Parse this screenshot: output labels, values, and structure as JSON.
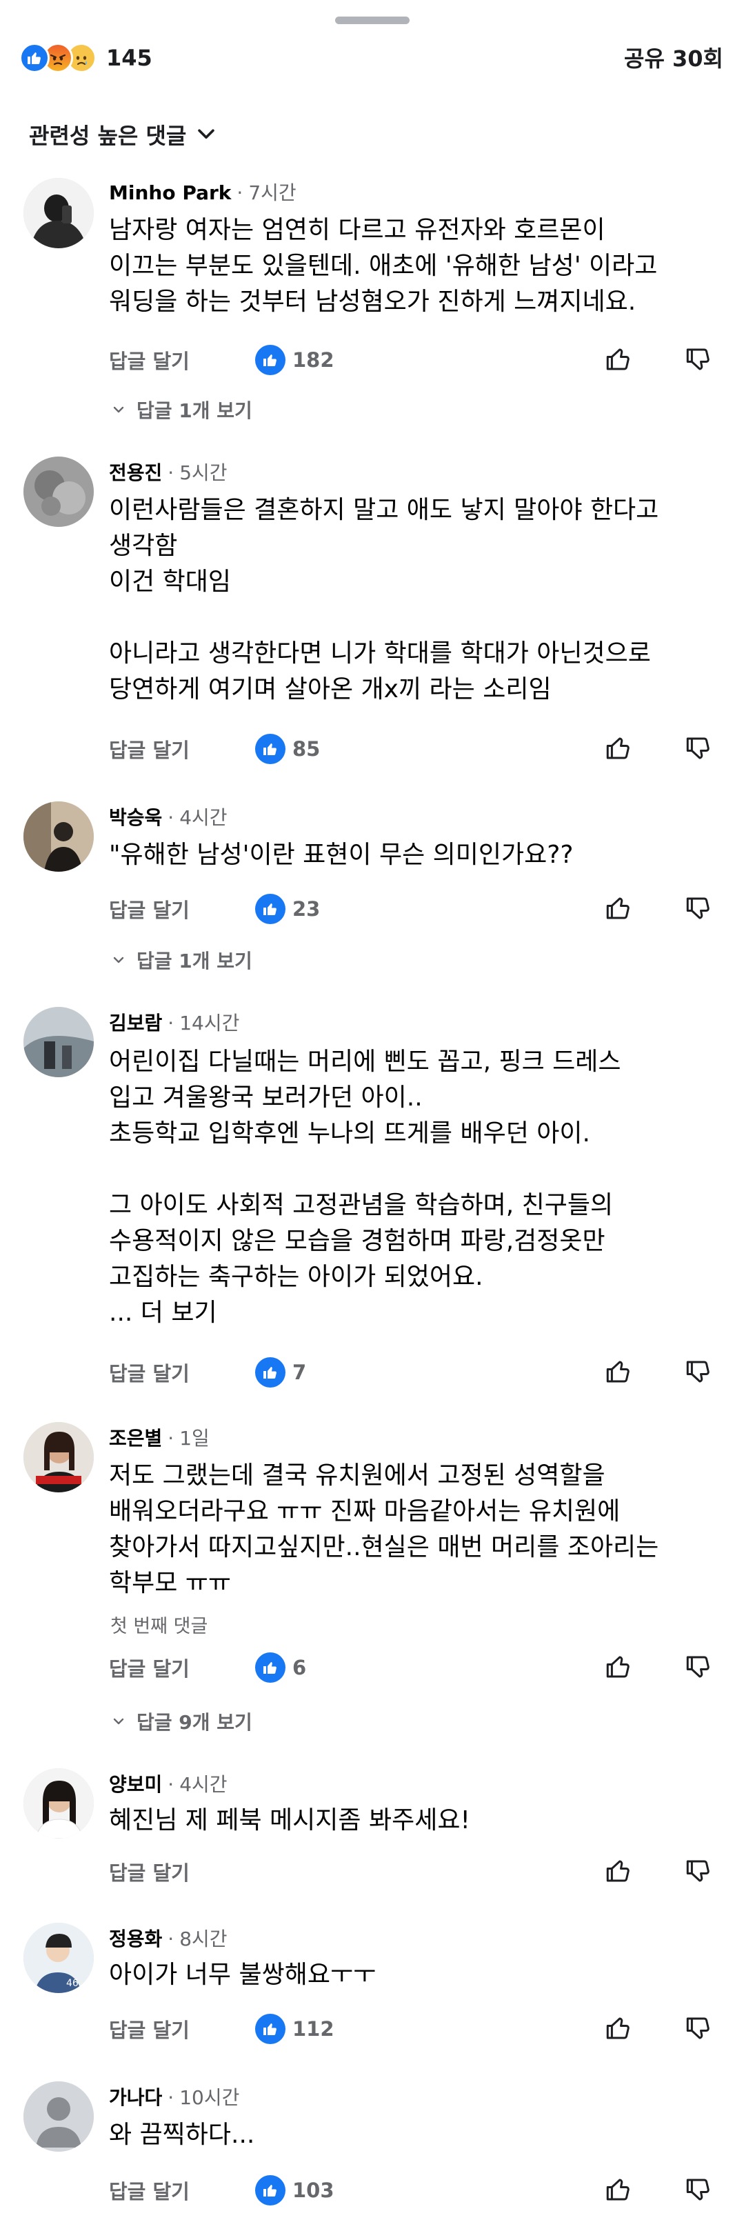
{
  "header": {
    "reaction_count": "145",
    "share_count": "공유 30회",
    "reactions": [
      "like-icon",
      "angry-icon",
      "sad-icon"
    ]
  },
  "sort": {
    "label": "관련성 높은 댓글"
  },
  "actions": {
    "reply": "답글 달기"
  },
  "comments": [
    {
      "author": "Minho Park",
      "time": "7시간",
      "text": "남자랑 여자는 엄연히 다르고 유전자와 호르몬이\n이끄는 부분도 있을텐데. 애초에 '유해한 남성' 이라고\n워딩을 하는 것부터 남성혐오가 진하게 느껴지네요.",
      "likes": "182",
      "replies": "답글 1개 보기"
    },
    {
      "author": "전용진",
      "time": "5시간",
      "text": "이런사람들은 결혼하지 말고 애도 낳지 말아야 한다고\n생각함\n이건 학대임\n\n아니라고 생각한다면 니가 학대를 학대가 아닌것으로\n당연하게 여기며 살아온 개x끼 라는 소리임",
      "likes": "85"
    },
    {
      "author": "박승욱",
      "time": "4시간",
      "text": "\"유해한 남성'이란 표현이 무슨 의미인가요??",
      "likes": "23",
      "replies": "답글 1개 보기"
    },
    {
      "author": "김보람",
      "time": "14시간",
      "text": "어린이집 다닐때는 머리에 삔도 꼽고, 핑크 드레스\n입고 겨울왕국 보러가던 아이..\n초등학교 입학후엔 누나의 뜨게를 배우던 아이.\n\n그 아이도 사회적 고정관념을 학습하며, 친구들의\n수용적이지 않은 모습을 경험하며 파랑,검정옷만\n고집하는 축구하는 아이가 되었어요.\n... 더 보기",
      "likes": "7"
    },
    {
      "author": "조은별",
      "time": "1일",
      "text": "저도 그랬는데 결국 유치원에서 고정된 성역할을\n배워오더라구요 ㅠㅠ 진짜 마음같아서는 유치원에\n찾아가서 따지고싶지만..현실은 매번 머리를 조아리는\n학부모 ㅠㅠ",
      "first_label": "첫 번째 댓글",
      "likes": "6",
      "replies": "답글 9개 보기"
    },
    {
      "author": "양보미",
      "time": "4시간",
      "text": "혜진님 제 페북 메시지좀 봐주세요!"
    },
    {
      "author": "정용화",
      "time": "8시간",
      "text": "아이가 너무 불쌍해요ㅜㅜ",
      "likes": "112"
    },
    {
      "author": "가나다",
      "time": "10시간",
      "text": "와 끔찍하다...",
      "likes": "103"
    }
  ]
}
